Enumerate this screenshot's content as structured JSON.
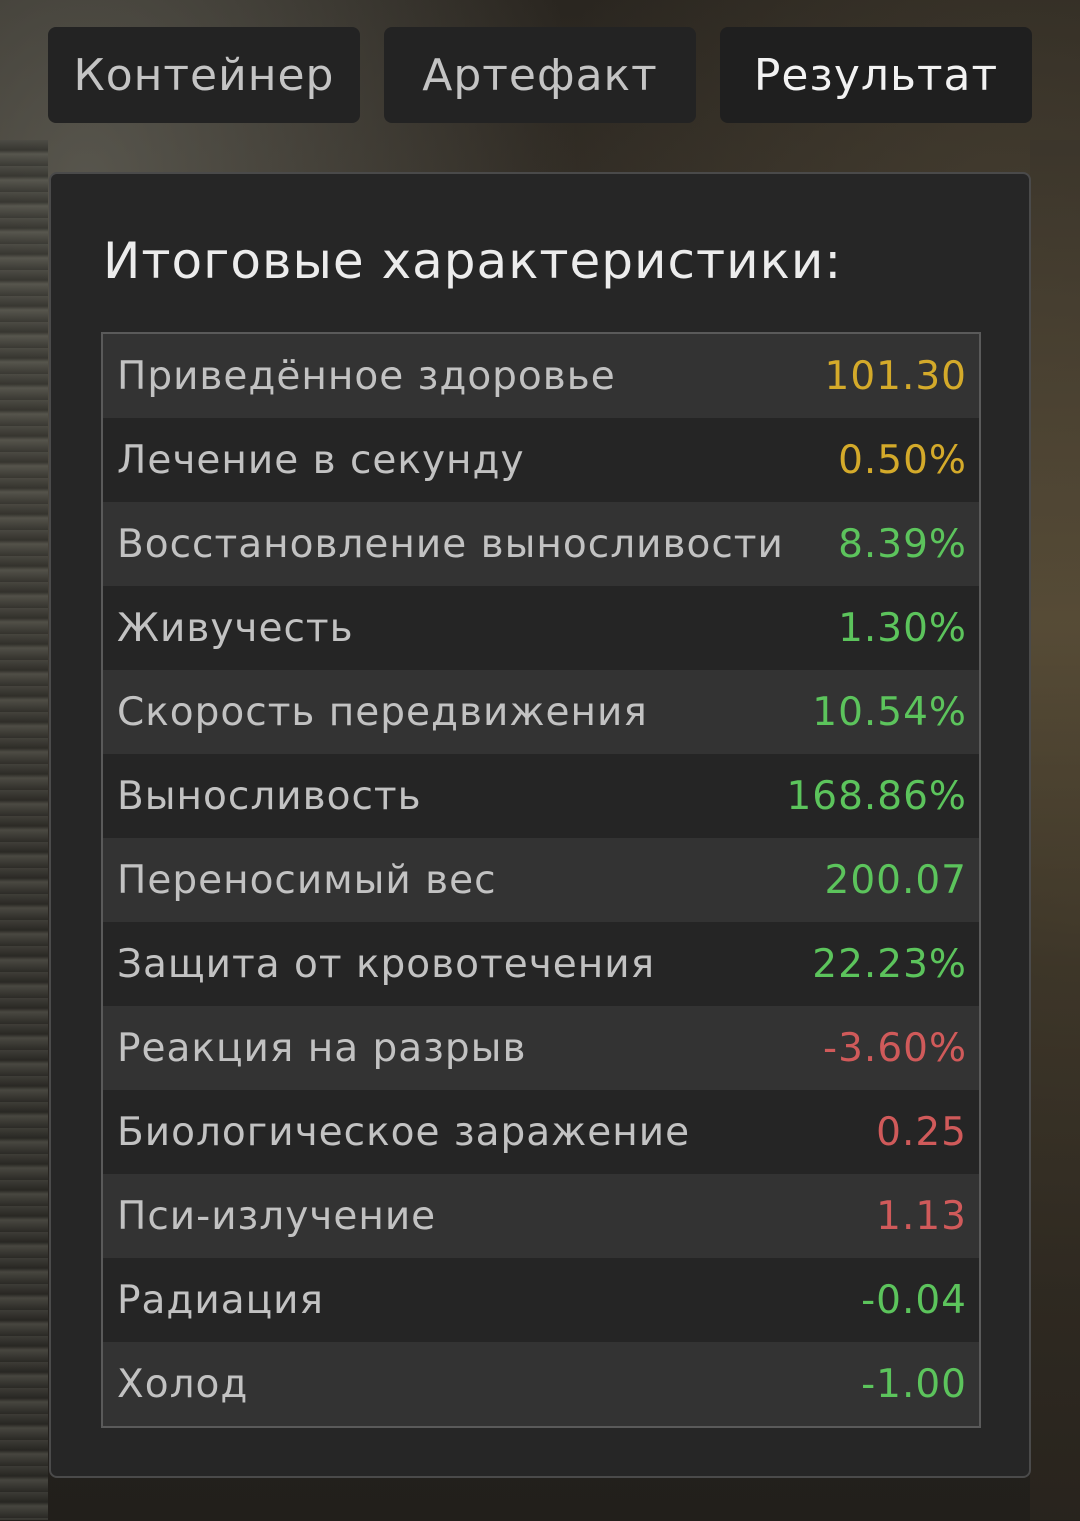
{
  "tabs": [
    {
      "label": "Контейнер",
      "active": false
    },
    {
      "label": "Артефакт",
      "active": false
    },
    {
      "label": "Результат",
      "active": true
    }
  ],
  "panel": {
    "title": "Итоговые характеристики:",
    "stats": [
      {
        "label": "Приведённое здоровье",
        "value": "101.30",
        "color": "yellow"
      },
      {
        "label": "Лечение в секунду",
        "value": "0.50%",
        "color": "yellow"
      },
      {
        "label": "Восстановление выносливости",
        "value": "8.39%",
        "color": "green"
      },
      {
        "label": "Живучесть",
        "value": "1.30%",
        "color": "green"
      },
      {
        "label": "Скорость передвижения",
        "value": "10.54%",
        "color": "green"
      },
      {
        "label": "Выносливость",
        "value": "168.86%",
        "color": "green"
      },
      {
        "label": "Переносимый вес",
        "value": "200.07",
        "color": "green"
      },
      {
        "label": "Защита от кровотечения",
        "value": "22.23%",
        "color": "green"
      },
      {
        "label": "Реакция на разрыв",
        "value": "-3.60%",
        "color": "red"
      },
      {
        "label": "Биологическое заражение",
        "value": "0.25",
        "color": "red"
      },
      {
        "label": "Пси-излучение",
        "value": "1.13",
        "color": "red"
      },
      {
        "label": "Радиация",
        "value": "-0.04",
        "color": "green"
      },
      {
        "label": "Холод",
        "value": "-1.00",
        "color": "green"
      }
    ]
  },
  "colors": {
    "yellow": "#d4aa2a",
    "green": "#5cc45c",
    "red": "#d05a5a"
  }
}
